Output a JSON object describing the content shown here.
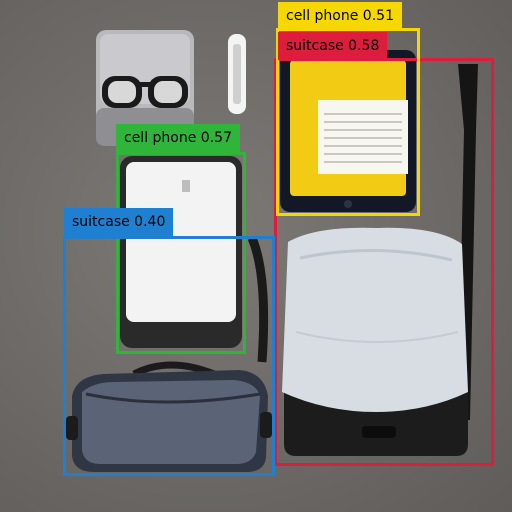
{
  "detections": [
    {
      "label": "cell phone 0.51",
      "color": "#f6d800",
      "text_color": "#000000"
    },
    {
      "label": "suitcase 0.58",
      "color": "#dc1e3c",
      "text_color": "#000000"
    },
    {
      "label": "cell phone 0.57",
      "color": "#2fb53a",
      "text_color": "#000000"
    },
    {
      "label": "suitcase 0.40",
      "color": "#1f7fd0",
      "text_color": "#000000"
    }
  ],
  "scene_objects": [
    "glasses-case",
    "eyeglasses",
    "pen",
    "tablet",
    "white-phone",
    "strap",
    "gray-bag",
    "black-bag-with-cloth"
  ]
}
